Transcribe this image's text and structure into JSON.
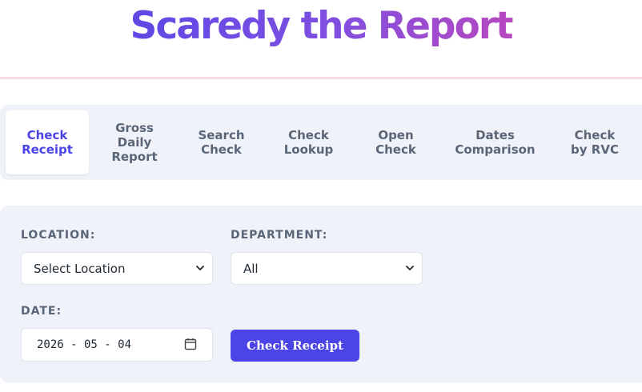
{
  "header": {
    "title": "Scaredy the Report"
  },
  "tabs": [
    {
      "label_lines": [
        "Check",
        "Receipt"
      ],
      "active": true
    },
    {
      "label_lines": [
        "Gross",
        "Daily",
        "Report"
      ]
    },
    {
      "label_lines": [
        "Search",
        "Check"
      ]
    },
    {
      "label_lines": [
        "Check",
        "Lookup"
      ]
    },
    {
      "label_lines": [
        "Open",
        "Check"
      ]
    },
    {
      "label_lines": [
        "Dates",
        "Comparison"
      ]
    },
    {
      "label_lines": [
        "Check",
        "by RVC"
      ]
    }
  ],
  "form": {
    "location": {
      "label": "LOCATION:",
      "value": "Select Location"
    },
    "department": {
      "label": "DEPARTMENT:",
      "value": "All"
    },
    "date": {
      "label": "DATE:",
      "value": "2026 - 05 - 04"
    },
    "submit_label": "Check Receipt"
  },
  "colors": {
    "accent": "#4b44e6",
    "title_gradient": [
      "#4b44e6",
      "#7d4fe2",
      "#de43a8"
    ],
    "panel_bg": "#eff3f9",
    "tab_text": "#5a6577"
  },
  "icons": {
    "select_chevron": "chevron-down-icon",
    "date_picker": "calendar-icon"
  }
}
